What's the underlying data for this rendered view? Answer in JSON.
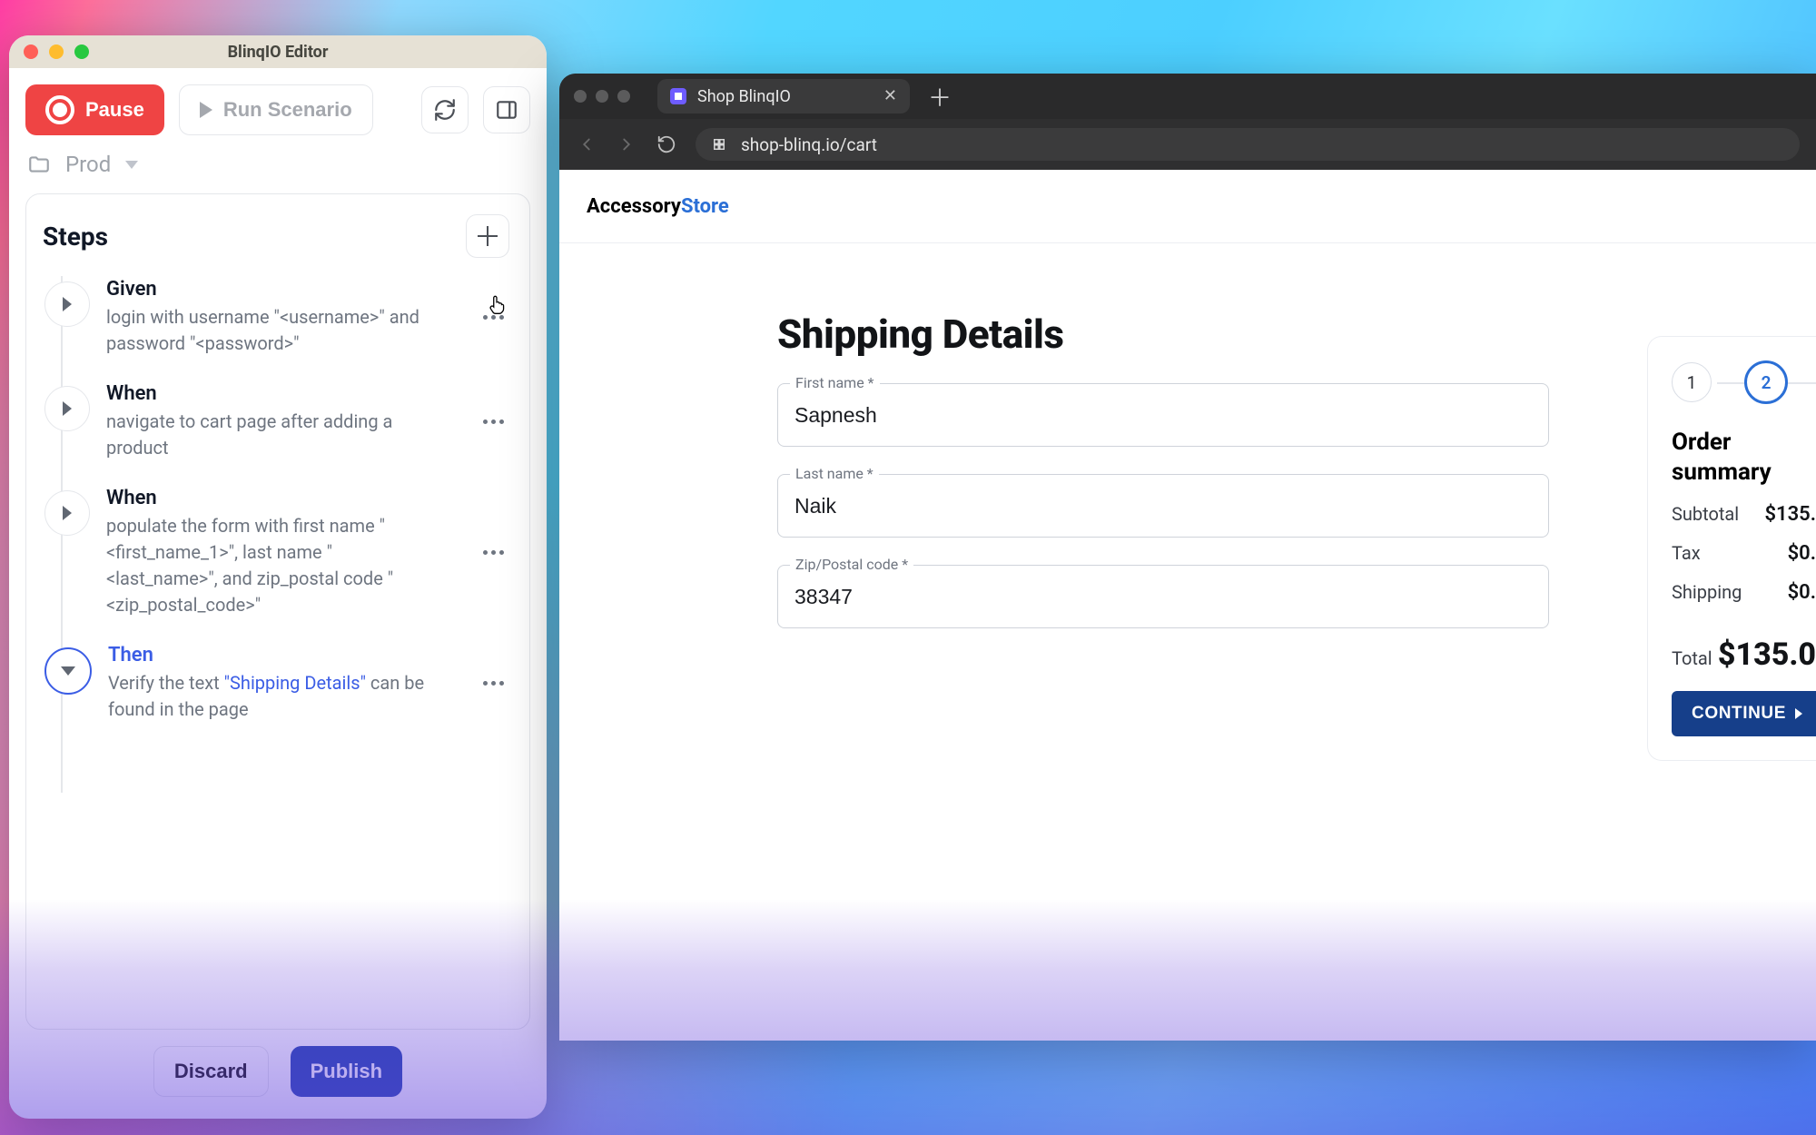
{
  "editor": {
    "title": "BlinqIO Editor",
    "pause_label": "Pause",
    "run_label": "Run Scenario",
    "environment": "Prod",
    "steps_header": "Steps",
    "discard_label": "Discard",
    "publish_label": "Publish",
    "steps": [
      {
        "keyword": "Given",
        "description": "login with username \"<username>\" and password \"<password>\""
      },
      {
        "keyword": "When",
        "description": "navigate to cart page after adding a product"
      },
      {
        "keyword": "When",
        "description": "populate the form with first name \"<first_name_1>\", last name \"<last_name>\", and zip_postal code \"<zip_postal_code>\""
      },
      {
        "keyword": "Then",
        "description_pre": "Verify the text ",
        "highlight": "\"Shipping Details\"",
        "description_post": " can be found in the page"
      }
    ]
  },
  "browser": {
    "tab_title": "Shop BlinqIO",
    "url": "shop-blinq.io/cart"
  },
  "store": {
    "brand_primary": "Accessory",
    "brand_accent": "Store",
    "heading": "Shipping Details",
    "fields": {
      "first_name": {
        "label": "First name *",
        "value": "Sapnesh"
      },
      "last_name": {
        "label": "Last name *",
        "value": "Naik"
      },
      "zip": {
        "label": "Zip/Postal code *",
        "value": "38347"
      }
    },
    "summary": {
      "step1": "1",
      "step2": "2",
      "title": "Order summary",
      "rows": {
        "subtotal": {
          "label": "Subtotal",
          "value": "$135."
        },
        "tax": {
          "label": "Tax",
          "value": "$0."
        },
        "shipping": {
          "label": "Shipping",
          "value": "$0."
        }
      },
      "total_label": "Total",
      "total_value": "$135.0",
      "continue_label": "CONTINUE"
    }
  }
}
